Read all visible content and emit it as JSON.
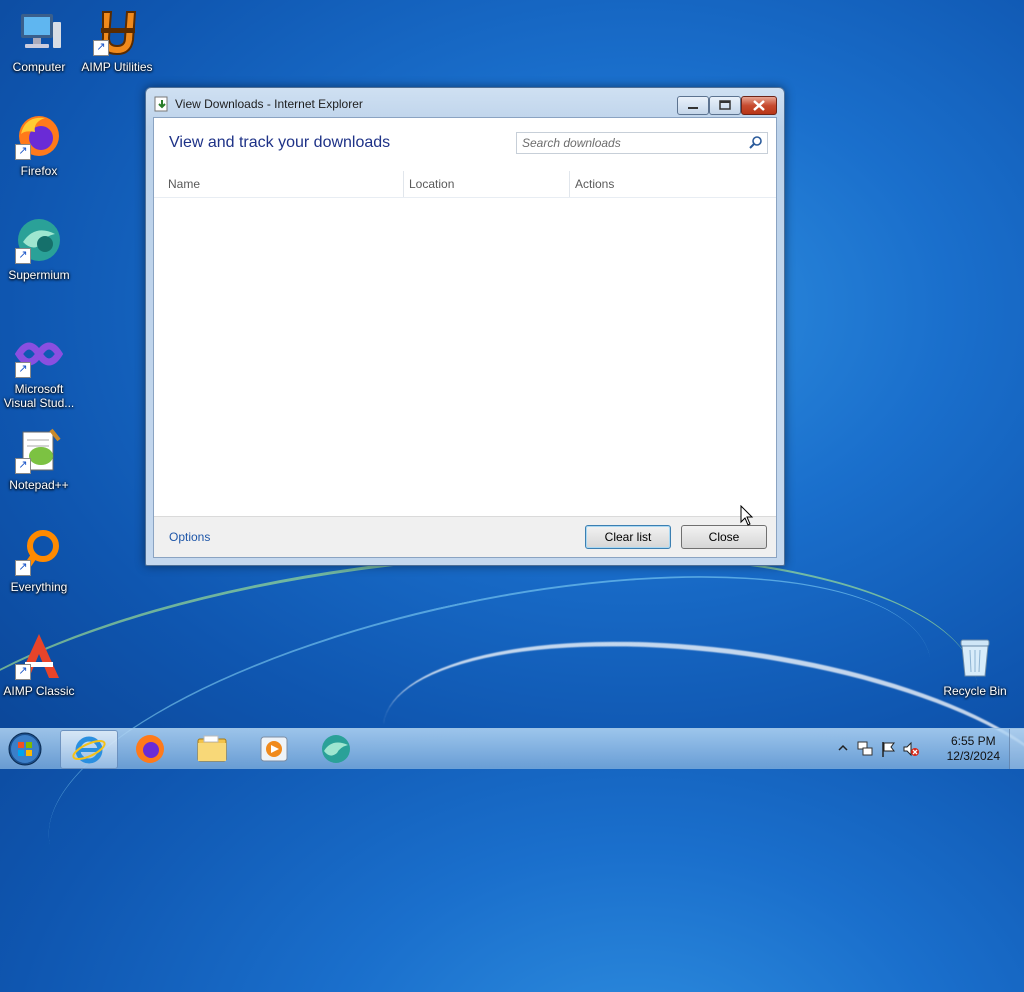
{
  "desktop": {
    "icons": [
      {
        "label": "Computer",
        "icon": "computer-icon"
      },
      {
        "label": "AIMP Utilities",
        "icon": "aimp-utilities-icon"
      },
      {
        "label": "Firefox",
        "icon": "firefox-icon"
      },
      {
        "label": "Supermium",
        "icon": "supermium-icon"
      },
      {
        "label": "Microsoft Visual Stud...",
        "icon": "visual-studio-icon"
      },
      {
        "label": "Notepad++",
        "icon": "notepadpp-icon"
      },
      {
        "label": "Everything",
        "icon": "everything-icon"
      },
      {
        "label": "AIMP Classic",
        "icon": "aimp-classic-icon"
      },
      {
        "label": "Recycle Bin",
        "icon": "recycle-bin-icon"
      }
    ]
  },
  "window": {
    "title": "View Downloads - Internet Explorer",
    "heading": "View and track your downloads",
    "search_placeholder": "Search downloads",
    "columns": [
      "Name",
      "Location",
      "Actions"
    ],
    "options_link": "Options",
    "clear_button": "Clear list",
    "close_button": "Close"
  },
  "taskbar": {
    "apps": [
      "start-orb-icon",
      "internet-explorer-icon",
      "firefox-icon",
      "file-explorer-icon",
      "media-player-icon",
      "supermium-icon"
    ],
    "clock_time": "6:55 PM",
    "clock_date": "12/3/2024"
  },
  "colors": {
    "heading": "#1e3287",
    "link": "#1e56a8",
    "desktop_blue": "#1a6fcc"
  }
}
